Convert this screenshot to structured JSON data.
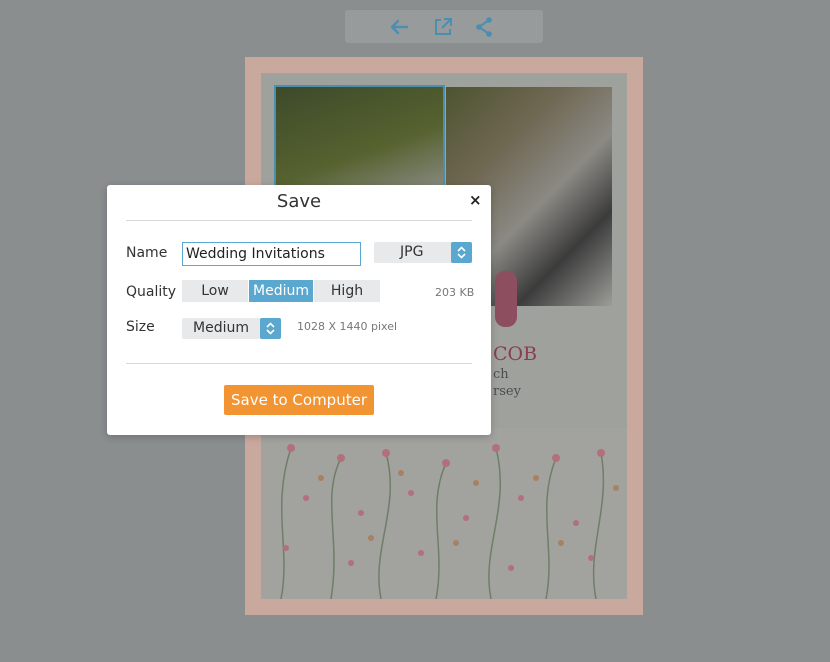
{
  "toolbar": {
    "icons": [
      "back-arrow-icon",
      "external-link-icon",
      "share-icon"
    ],
    "icon_color": "#4a8fb0"
  },
  "card": {
    "names_fragment": "COB",
    "line1_fragment": "ch",
    "line2_fragment": "rsey"
  },
  "modal": {
    "title": "Save",
    "close_label": "×",
    "name_label": "Name",
    "name_value": "Wedding Invitations",
    "format_value": "JPG",
    "quality_label": "Quality",
    "quality_options": [
      "Low",
      "Medium",
      "High"
    ],
    "quality_selected": "Medium",
    "file_size": "203 KB",
    "size_label": "Size",
    "size_value": "Medium",
    "dimensions": "1028 X 1440 pixel",
    "save_button": "Save to Computer"
  },
  "colors": {
    "accent": "#5aa7cf",
    "primary_button": "#f39433",
    "overlay": "#8a8e8f"
  }
}
